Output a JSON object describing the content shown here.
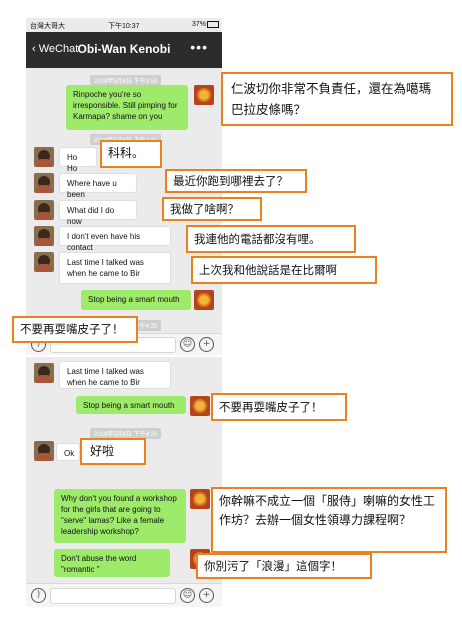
{
  "status_bar": {
    "carrier": "台灣大哥大",
    "time": "下午10:37",
    "battery": "37%"
  },
  "nav": {
    "back_label": "WeChat",
    "title": "Obi-Wan Kenobi",
    "more": "•••"
  },
  "timestamps": {
    "t1": "2018年5月6日 下午3:53",
    "t2": "2018年5月6日 下午4:21",
    "t3": "2018年5月6日 下午4:25"
  },
  "messages": [
    {
      "from": "me",
      "text": "Rinpoche you're so irresponsible. Still pimping for Karmapa? shame on you"
    },
    {
      "from": "them",
      "text": "Ho Ho"
    },
    {
      "from": "them",
      "text": "Where have u been"
    },
    {
      "from": "them",
      "text": "What did I do now"
    },
    {
      "from": "them",
      "text": "I don't even have his contact"
    },
    {
      "from": "them",
      "text": "Last time I talked was when he came to Bir"
    },
    {
      "from": "me",
      "text": "Stop being a smart mouth"
    },
    {
      "from": "them",
      "text": "Ok"
    },
    {
      "from": "me",
      "text": "Why don't you found a workshop for the girls that are going to \"serve\" lamas? Like a female leadership workshop?"
    },
    {
      "from": "me",
      "text": "Don't abuse the word \"romantic \""
    }
  ],
  "annotations": [
    "仁波切你非常不負責任，還在為噶瑪巴拉皮條嗎？",
    "科科。",
    "最近你跑到哪裡去了？",
    "我做了啥啊？",
    "我連他的電話都沒有哩。",
    "上次我和他說話是在比爾啊",
    "不要再耍嘴皮子了！",
    "好啦",
    "你幹嘛不成立一個「服侍」喇嘛的女性工作坊？去辦一個女性領導力課程啊？",
    "你別污了「浪漫」這個字！"
  ],
  "input_icons": {
    "voice": "voice-icon",
    "emoji": "emoji-icon",
    "plus": "plus-icon"
  },
  "colors": {
    "annotation_border": "#e8821e",
    "outgoing_bubble": "#9eea6a",
    "nav_bg": "#2c2c2c",
    "chat_bg": "#ebebeb"
  }
}
